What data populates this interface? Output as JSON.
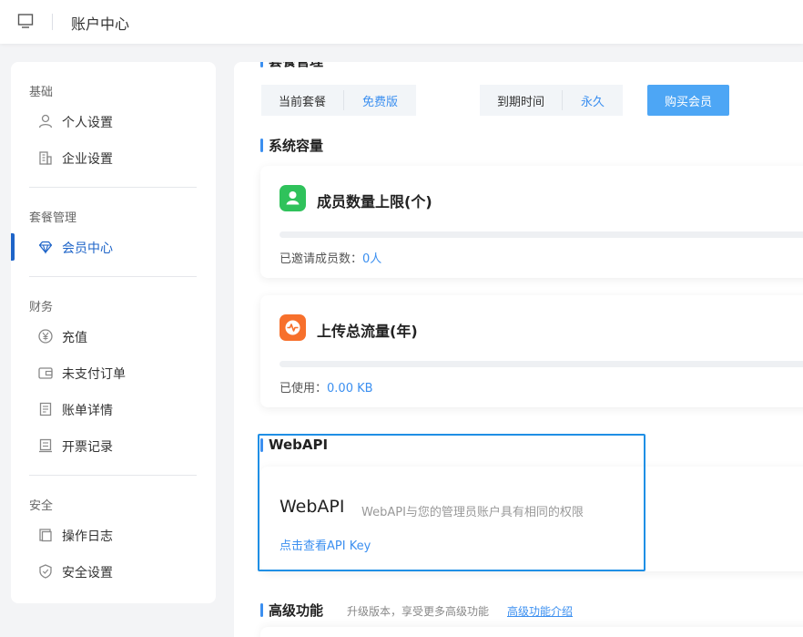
{
  "topbar": {
    "title": "账户中心",
    "toggle_icon": "sidebar-toggle-icon"
  },
  "sidebar": {
    "groups": [
      {
        "title": "基础",
        "items": [
          {
            "label": "个人设置",
            "icon": "user-icon"
          },
          {
            "label": "企业设置",
            "icon": "building-icon"
          }
        ]
      },
      {
        "title": "套餐管理",
        "items": [
          {
            "label": "会员中心",
            "icon": "diamond-icon",
            "active": true
          }
        ]
      },
      {
        "title": "财务",
        "items": [
          {
            "label": "充值",
            "icon": "yen-icon"
          },
          {
            "label": "未支付订单",
            "icon": "wallet-icon"
          },
          {
            "label": "账单详情",
            "icon": "bill-icon"
          },
          {
            "label": "开票记录",
            "icon": "invoice-icon"
          }
        ]
      },
      {
        "title": "安全",
        "items": [
          {
            "label": "操作日志",
            "icon": "log-icon"
          },
          {
            "label": "安全设置",
            "icon": "shield-icon"
          }
        ]
      }
    ]
  },
  "plan": {
    "section_title": "套餐管理",
    "current_label": "当前套餐",
    "current_value": "免费版",
    "expire_label": "到期时间",
    "expire_value": "永久",
    "buy_button": "购买会员"
  },
  "capacity": {
    "section_title": "系统容量",
    "members": {
      "title": "成员数量上限(个)",
      "stat_label": "已邀请成员数：",
      "stat_value": "0人",
      "progress": 0,
      "icon": "members-icon",
      "icon_color": "#2fc25b"
    },
    "traffic": {
      "title": "上传总流量(年)",
      "stat_label": "已使用：",
      "stat_value": "0.00 KB",
      "progress": 0,
      "icon": "pulse-icon",
      "icon_color": "#f7702c"
    }
  },
  "webapi": {
    "section_title": "WebAPI",
    "card_title": "WebAPI",
    "description": "WebAPI与您的管理员账户具有相同的权限",
    "link": "点击查看API Key"
  },
  "advanced": {
    "section_title": "高级功能",
    "subtitle": "升级版本，享受更多高级功能",
    "link": "高级功能介绍"
  },
  "colors": {
    "accent": "#3b8ff0",
    "active_nav": "#1e64c8",
    "buy_button": "#4da6f5",
    "highlight": "#1f8fe5"
  }
}
